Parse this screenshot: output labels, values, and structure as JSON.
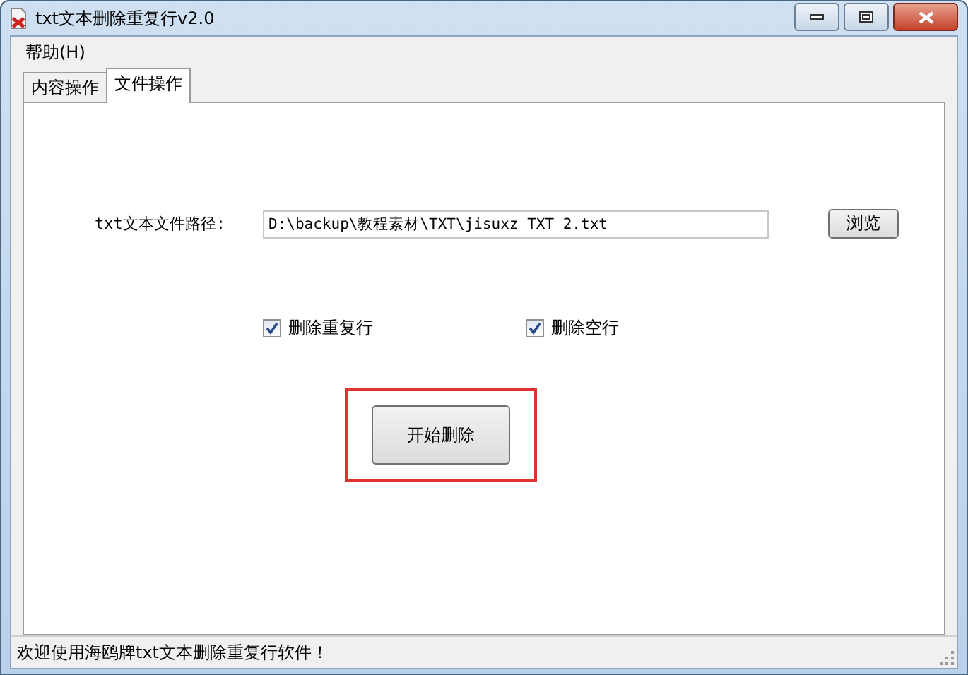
{
  "window": {
    "title": "txt文本删除重复行v2.0"
  },
  "menu": [
    "帮助(H)"
  ],
  "tabs": [
    {
      "label": "内容操作",
      "selected": false
    },
    {
      "label": "文件操作",
      "selected": true
    }
  ],
  "path_row": {
    "label": "txt文本文件路径:",
    "value": "D:\\backup\\教程素材\\TXT\\jisuxz_TXT 2.txt",
    "button": "浏览"
  },
  "options": [
    {
      "label": "删除重复行",
      "checked": true
    },
    {
      "label": "删除空行",
      "checked": true
    }
  ],
  "start_button": {
    "label": "开始删除",
    "highlighted": true
  },
  "status_bar": "欢迎使用海鸥牌txt文本删除重复行软件！"
}
